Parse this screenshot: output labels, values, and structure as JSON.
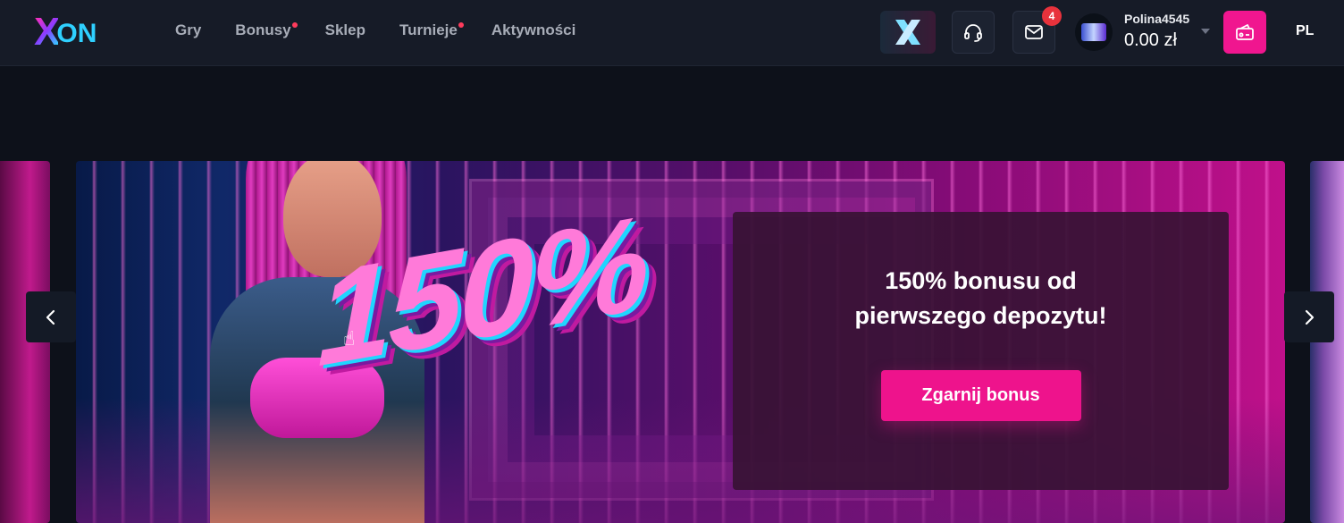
{
  "brand": {
    "logo_x": "X",
    "logo_on": "ON"
  },
  "nav": [
    {
      "label": "Gry",
      "dot": false
    },
    {
      "label": "Bonusy",
      "dot": true
    },
    {
      "label": "Sklep",
      "dot": false
    },
    {
      "label": "Turnieje",
      "dot": true
    },
    {
      "label": "Aktywności",
      "dot": false
    }
  ],
  "header": {
    "mail_badge": "4",
    "username": "Polina4545",
    "balance": "0.00 zł",
    "language": "PL"
  },
  "icons": {
    "x_button": "x-logo-icon",
    "support": "headset-icon",
    "mail": "envelope-icon",
    "cashier": "wallet-icon",
    "prev": "chevron-left-icon",
    "next": "chevron-right-icon"
  },
  "banner": {
    "big_number": "150%",
    "title": "150% bonusu od pierwszego depozytu!",
    "cta_label": "Zgarnij bonus"
  },
  "colors": {
    "accent": "#ee138c",
    "header_bg": "#161b27",
    "page_bg": "#0d111a",
    "badge": "#e8323c"
  }
}
